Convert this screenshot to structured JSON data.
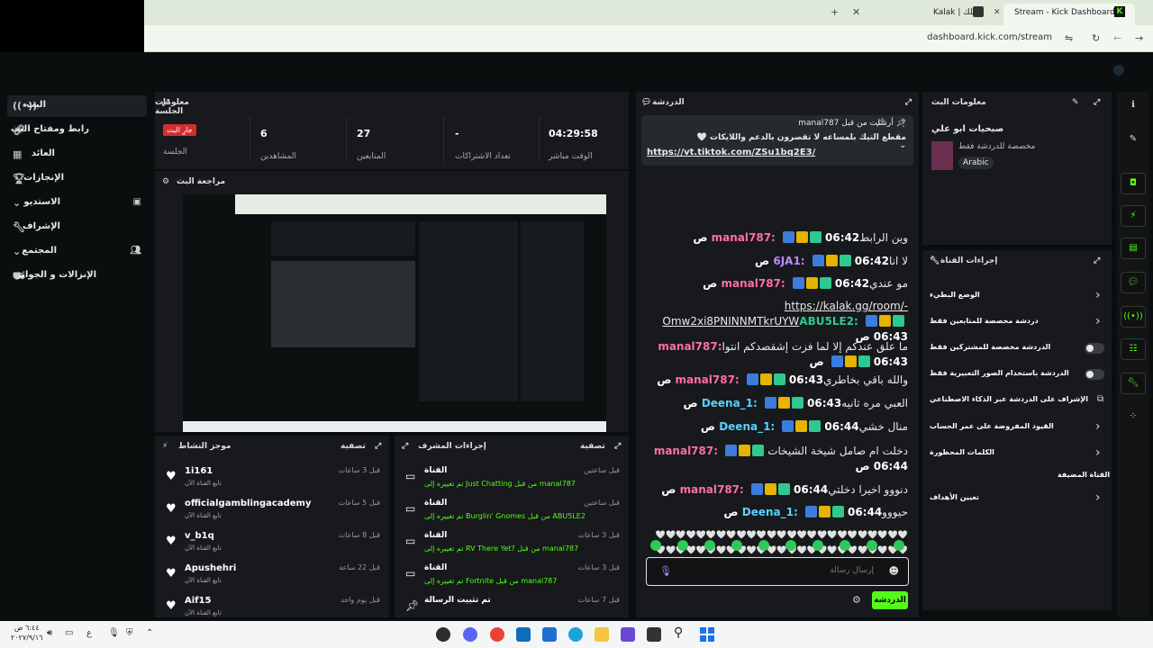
{
  "browser": {
    "tabs": [
      {
        "label": "Kalak | كلك"
      },
      {
        "label": "Stream - Kick Dashboard"
      }
    ],
    "url": "dashboard.kick.com/stream"
  },
  "sidebar": {
    "items": [
      {
        "label": "البث"
      },
      {
        "label": "رابط ومفتاح البث"
      },
      {
        "label": "العائد"
      },
      {
        "label": "الإنجازات"
      },
      {
        "label": "الاستديو"
      },
      {
        "label": "الإشراف"
      },
      {
        "label": "المجتمع"
      },
      {
        "label": "الإنزالات و الجوائز"
      }
    ]
  },
  "session": {
    "title": "معلومات الجلسة",
    "live_badge": "جارِ البث",
    "session_label": "الجلسة",
    "stats": [
      {
        "value": "6",
        "label": "المشاهدين"
      },
      {
        "value": "27",
        "label": "المتابعين"
      },
      {
        "value": "-",
        "label": "تعداد الاشتراكات"
      },
      {
        "value": "04:29:58",
        "label": "الوقت مباشر"
      }
    ]
  },
  "preview": {
    "title": "مراجعة البث"
  },
  "activity": {
    "title": "موجز النشاط",
    "filter": "تصفية",
    "items": [
      {
        "name": "1i161",
        "sub": "تابع القناة الآن",
        "time": "قبل 3 ساعات"
      },
      {
        "name": "officialgamblingacademy",
        "sub": "تابع القناة الآن",
        "time": "قبل 5 ساعات"
      },
      {
        "name": "v_b1q",
        "sub": "تابع القناة الآن",
        "time": "قبل 8 ساعات"
      },
      {
        "name": "Apushehri",
        "sub": "تابع القناة الآن",
        "time": "قبل 22 ساعة"
      },
      {
        "name": "Aif15",
        "sub": "تابع القناة الآن",
        "time": "قبل يوم واحد"
      }
    ]
  },
  "mod_actions": {
    "title": "إجراءات المشرف",
    "filter": "تصفية",
    "items": [
      {
        "title": "القناة",
        "detail": "تم تغييره إلى Just Chatting من قبل manal787",
        "time": "قبل ساعتين"
      },
      {
        "title": "القناة",
        "detail": "تم تغييره إلى Burglin' Gnomes من قبل ABU5LE2",
        "time": "قبل ساعتين"
      },
      {
        "title": "القناة",
        "detail": "تم تغييره إلى RV There Yet? من قبل manal787",
        "time": "قبل 3 ساعات"
      },
      {
        "title": "القناة",
        "detail": "تم تغييره إلى Fortnite من قبل manal787",
        "time": "قبل 3 ساعات"
      },
      {
        "title": "تم تثبيت الرسالة",
        "detail": "",
        "time": "قبل 7 ساعات"
      }
    ]
  },
  "chat": {
    "title": "الدردشة",
    "pinned_by": "أرسلت من قبل manal787",
    "pinned_text": "مقطع التيك بلمساعه لا تقصرون بالدعم واللايكات 🤍",
    "pinned_link": "https://vt.tiktok.com/ZSu1bq2E3/",
    "messages": [
      {
        "time": "06:42 ص",
        "user": "manal787",
        "color": "#ff6f9f",
        "text": "وين الرابط"
      },
      {
        "time": "06:42 ص",
        "user": "6JA1",
        "color": "#b68cff",
        "text": "لا انا"
      },
      {
        "time": "06:42 ص",
        "user": "manal787",
        "color": "#ff6f9f",
        "text": "مو عندي"
      },
      {
        "time": "06:43 ص",
        "user": "ABU5LE2",
        "color": "#2fc88f",
        "text": "https://kalak.gg/room/-Omw2xi8PNINNMTkrUYW"
      },
      {
        "time": "06:43 ص",
        "user": "manal787",
        "color": "#ff6f9f",
        "text": "ما علق عندكم إلا لما فزت إشقصدكم انتوا"
      },
      {
        "time": "06:43 ص",
        "user": "manal787",
        "color": "#ff6f9f",
        "text": "والله باقي بخاطري"
      },
      {
        "time": "06:43 ص",
        "user": "Deena_1",
        "color": "#5ad1ff",
        "text": "العبي مره ثانيه"
      },
      {
        "time": "06:44 ص",
        "user": "Deena_1",
        "color": "#5ad1ff",
        "text": "منال خشي"
      },
      {
        "time": "06:44 ص",
        "user": "manal787",
        "color": "#ff6f9f",
        "text": "دخلت ام صامل شيخة الشيخات"
      },
      {
        "time": "06:44 ص",
        "user": "manal787",
        "color": "#ff6f9f",
        "text": "دنووو اخيرا دخلتي"
      },
      {
        "time": "06:44 ص",
        "user": "Deena_1",
        "color": "#5ad1ff",
        "text": "حيووو"
      },
      {
        "time": "06:44 ص",
        "user": "Deena_1",
        "color": "#5ad1ff",
        "text": "🤍🤍🤍🤍🤍🤍🤍🤍🤍🤍🤍🤍🤍🤍🤍🤍🤍🤍🤍🤍🤍🤍🤍🤍🤍🤍🤍🤍🤍🤍🤍🤍🤍🤍🤍🤍🤍🤍🤍🤍🤍🤍🤍🤍🤍🤍🤍🤍🤍🤍🤍"
      }
    ],
    "input_placeholder": "إرسال رسالة",
    "send_label": "الدردشة"
  },
  "stream_info": {
    "title": "معلومات البث",
    "stream_title": "صبحيات ابو علي",
    "subtitle": "مخصصة للدردشة فقط",
    "language": "Arabic"
  },
  "channel_actions": {
    "title": "إجراءات القناة",
    "items": [
      {
        "label": "الوضع البطيء",
        "control": "chevron"
      },
      {
        "label": "دردشة مخصصة للمتابعين فقط",
        "control": "chevron"
      },
      {
        "label": "الدردشة مخصصة للمشتركين فقط",
        "control": "toggle"
      },
      {
        "label": "الدردشة باستخدام الصور التعبيرية فقط",
        "control": "toggle"
      },
      {
        "label": "الإشراف على الدردشة عبر الذكاء الاصطناعي",
        "control": "external"
      },
      {
        "label": "القيود المفروضة على عمر الحساب",
        "control": "chevron"
      },
      {
        "label": "الكلمات المحظورة",
        "control": "chevron"
      },
      {
        "label": "القناة المضيفة",
        "control": "none"
      },
      {
        "label": "تعيين الأهداف",
        "control": "chevron"
      }
    ]
  },
  "taskbar": {
    "time": "٦:٤٤ ص",
    "date": "٢٠٢٧/٩/١٦",
    "lang": "ع"
  },
  "colors": {
    "accent": "#53fc18",
    "panel": "#17191c",
    "live_badge": "#d32f2f"
  }
}
